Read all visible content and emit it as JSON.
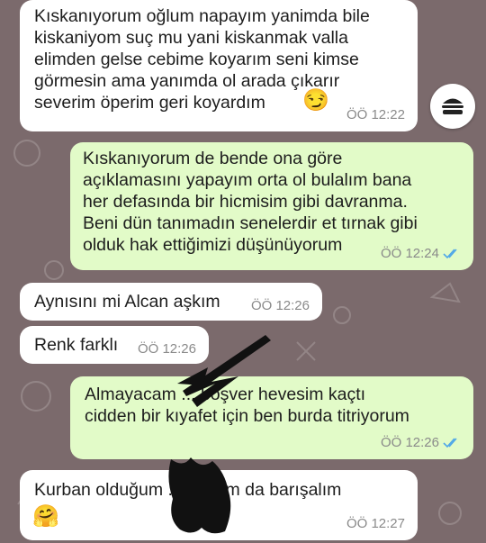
{
  "messages": [
    {
      "direction": "in",
      "text": "Kıskanıyorum oğlum napayım yanimda bile\nkiskaniyom suç mu yani kiskanmak valla\nelimden gelse cebime koyarım seni kimse\ngörmesin ama yanımda ol arada çıkarır\nseverim öperim geri koyardım",
      "emoji": "😏",
      "time": "ÖÖ 12:22"
    },
    {
      "direction": "out",
      "text": "Kıskanıyorum de bende ona göre\naçıklamasını yapayım orta ol bulalım bana\nher defasında bir hicmisim gibi davranma.\nBeni dün tanımadın senelerdir et tırnak gibi\nolduk hak ettiğimizi düşünüyorum",
      "time": "ÖÖ 12:24",
      "read": true
    },
    {
      "direction": "in",
      "text": "Aynısını mi Alcan aşkım",
      "time": "ÖÖ 12:26"
    },
    {
      "direction": "in",
      "text": "Renk farklı",
      "time": "ÖÖ 12:26"
    },
    {
      "direction": "out",
      "text": "Almayacam ... boşver hevesim kaçtı\ncidden bir kıyafet için ben burda titriyorum",
      "time": "ÖÖ 12:26",
      "read": true
    },
    {
      "direction": "in",
      "text": "Kurban olduğum ... sarılım da barışalım",
      "emoji": "🤗",
      "time": "ÖÖ 12:27"
    }
  ],
  "icons": {
    "scroll_fab": "burger-icon",
    "read_receipt": "double-check-icon"
  },
  "colors": {
    "incoming": "#ffffff",
    "outgoing": "#e2fbc8",
    "tick": "#4fa7e8",
    "background": "#7b6a6c"
  }
}
